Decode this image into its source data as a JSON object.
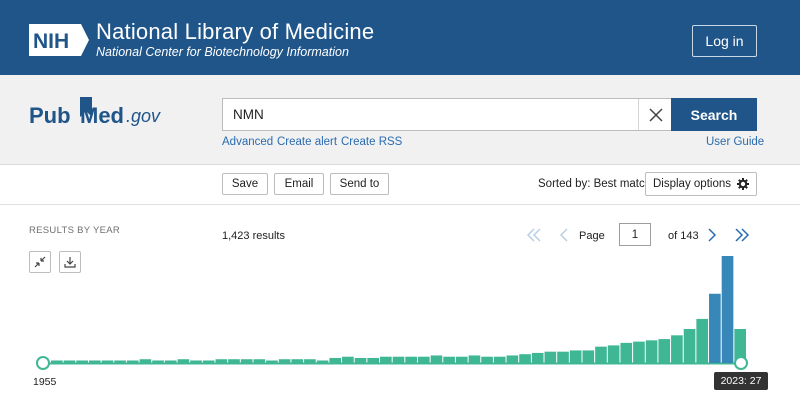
{
  "header": {
    "logo_text": "NIH",
    "title": "National Library of Medicine",
    "subtitle": "National Center for Biotechnology Information",
    "login_label": "Log in"
  },
  "search": {
    "logo_pub": "Pub",
    "logo_med": "Med",
    "logo_gov": ".gov",
    "query": "NMN",
    "button_label": "Search",
    "links": {
      "advanced": "Advanced",
      "create_alert": "Create alert",
      "create_rss": "Create RSS",
      "user_guide": "User Guide"
    }
  },
  "toolbar": {
    "save": "Save",
    "email": "Email",
    "send_to": "Send to",
    "sorted_by": "Sorted by: Best match",
    "display_options": "Display options"
  },
  "results": {
    "section_label": "RESULTS BY YEAR",
    "count_text": "1,423 results",
    "page_label": "Page",
    "page_value": "1",
    "of_text": "of 143"
  },
  "chart_data": {
    "type": "bar",
    "start_year_label": "1955",
    "tooltip": "2023: 27",
    "values": [
      2,
      2,
      2,
      2,
      2,
      2,
      2,
      3,
      2,
      2,
      3,
      2,
      2,
      3,
      3,
      3,
      3,
      2,
      3,
      3,
      3,
      2,
      4,
      5,
      4,
      4,
      5,
      5,
      5,
      5,
      6,
      5,
      5,
      6,
      5,
      5,
      6,
      7,
      8,
      9,
      9,
      10,
      10,
      13,
      14,
      16,
      17,
      18,
      19,
      22,
      27,
      35,
      55,
      85,
      27
    ],
    "colors": {
      "bar": "#3fb795",
      "bar_recent": "#3788b8",
      "baseline": "#3fb795"
    }
  }
}
